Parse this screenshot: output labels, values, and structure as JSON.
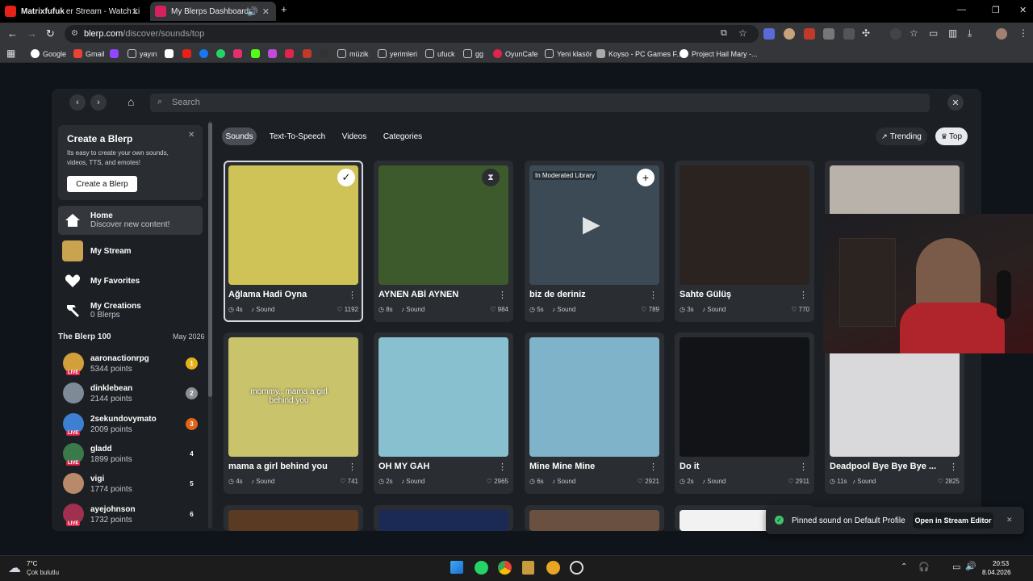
{
  "tabs": [
    {
      "title": "Matrixfufuk",
      "subtitle": "er Stream - Watch Li",
      "active": false
    },
    {
      "title": "My Blerps Dashboard",
      "active": true
    }
  ],
  "toolbar": {
    "url_host": "blerp.com",
    "url_path": "/discover/sounds/top"
  },
  "bookmarks": [
    "Google",
    "Gmail",
    "yayın",
    "müzik",
    "yerimleri",
    "ufuck",
    "gg",
    "OyunCafe",
    "Yeni klasör",
    "Koyso - PC Games F...",
    "Project Hail Mary -..."
  ],
  "search": {
    "placeholder": "Search"
  },
  "sidebar": {
    "create": {
      "title": "Create a Blerp",
      "desc": "Its easy to create your own sounds, videos, TTS, and emotes!",
      "button": "Create a Blerp"
    },
    "nav": [
      {
        "label": "Home",
        "sub": "Discover new content!",
        "icon": "home-icon"
      },
      {
        "label": "My Stream",
        "sub": "",
        "icon": "stream-avatar-icon"
      },
      {
        "label": "My Favorites",
        "sub": "",
        "icon": "heart-icon"
      },
      {
        "label": "My Creations",
        "sub": "0 Blerps",
        "icon": "hammer-icon"
      }
    ],
    "leaderboard": {
      "title": "The Blerp 100",
      "date": "May 2026",
      "rows": [
        {
          "name": "aaronactionrpg",
          "points": "5344 points",
          "rank": "1",
          "live": "LIVE",
          "rank_color": "#e6b21b"
        },
        {
          "name": "dinklebean",
          "points": "2144 points",
          "rank": "2",
          "live": "",
          "rank_color": "#8c9096"
        },
        {
          "name": "2sekundovymato",
          "points": "2009 points",
          "rank": "3",
          "live": "LIVE",
          "rank_color": "#e0651b"
        },
        {
          "name": "gladd",
          "points": "1899 points",
          "rank": "4",
          "live": "LIVE",
          "rank_color": ""
        },
        {
          "name": "vigi",
          "points": "1774 points",
          "rank": "5",
          "live": "",
          "rank_color": ""
        },
        {
          "name": "ayejohnson",
          "points": "1732 points",
          "rank": "6",
          "live": "LIVE",
          "rank_color": ""
        }
      ]
    }
  },
  "filters": {
    "tabs": [
      "Sounds",
      "Text-To-Speech",
      "Videos",
      "Categories"
    ],
    "active": "Sounds",
    "sort": [
      "Trending",
      "Top"
    ],
    "sort_active": "Top"
  },
  "cards": [
    {
      "title": "Ağlama Hadi Oyna",
      "duration": "4s",
      "type": "Sound",
      "likes": "1192",
      "badge": "check-icon",
      "bg": "#cfc257"
    },
    {
      "title": "AYNEN ABİ AYNEN",
      "duration": "8s",
      "type": "Sound",
      "likes": "984",
      "badge": "hourglass-icon",
      "bg": "#3d5a2c"
    },
    {
      "title": "biz de deriniz",
      "duration": "5s",
      "type": "Sound",
      "likes": "789",
      "badge": "plus-icon",
      "tag": "In Moderated Library",
      "bg": "#3b4a55"
    },
    {
      "title": "Sahte Gülüş",
      "duration": "3s",
      "type": "Sound",
      "likes": "770",
      "badge": "",
      "bg": "#2a2320"
    },
    {
      "title": "",
      "duration": "",
      "type": "",
      "likes": "",
      "badge": "",
      "bg": "#b8b2aa"
    },
    {
      "title": "mama a girl behind you",
      "duration": "4s",
      "type": "Sound",
      "likes": "741",
      "badge": "",
      "caption": "mommy.. mama a girl behind you",
      "bg": "#c9c46b"
    },
    {
      "title": "OH MY GAH",
      "duration": "2s",
      "type": "Sound",
      "likes": "2965",
      "badge": "",
      "bg": "#88c0cf"
    },
    {
      "title": "Mine Mine Mine",
      "duration": "6s",
      "type": "Sound",
      "likes": "2921",
      "badge": "",
      "bg": "#7fb3c9"
    },
    {
      "title": "Do it",
      "duration": "2s",
      "type": "Sound",
      "likes": "2911",
      "badge": "",
      "bg": "#121316"
    },
    {
      "title": "Deadpool Bye Bye Bye ...",
      "duration": "11s",
      "type": "Sound",
      "likes": "2825",
      "badge": "",
      "bg": "#d9d9dc"
    }
  ],
  "toast": {
    "message": "Pinned sound on Default Profile",
    "action": "Open in Stream Editor"
  },
  "taskbar": {
    "temp": "7°C",
    "weather": "Çok bulutlu",
    "time": "20:53",
    "date": "8.04.2026"
  },
  "colors": {
    "accent": "#1a8fd1",
    "background": "#1c1f23",
    "card": "#2a2d31",
    "live": "#e0244b",
    "success": "#3ec46d"
  }
}
